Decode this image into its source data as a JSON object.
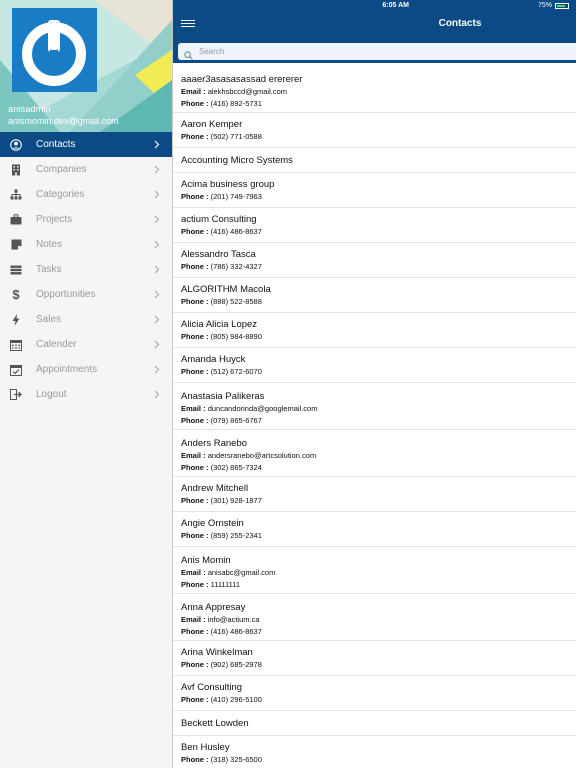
{
  "status_bar": {
    "time": "6:05 AM",
    "battery": "75%",
    "battery_level": 0.75
  },
  "navbar": {
    "title": "Contacts"
  },
  "search": {
    "placeholder": "Search"
  },
  "profile": {
    "name": "anisadmin",
    "email": "anismomin.dev@gmail.com"
  },
  "menu": [
    {
      "label": "Contacts",
      "icon": "user-circle-icon",
      "active": true
    },
    {
      "label": "Companies",
      "icon": "building-icon"
    },
    {
      "label": "Categories",
      "icon": "hierarchy-icon"
    },
    {
      "label": "Projects",
      "icon": "briefcase-icon"
    },
    {
      "label": "Notes",
      "icon": "note-icon"
    },
    {
      "label": "Tasks",
      "icon": "tasks-icon"
    },
    {
      "label": "Opportunities",
      "icon": "dollar-icon"
    },
    {
      "label": "Sales",
      "icon": "lightning-icon"
    },
    {
      "label": "Calender",
      "icon": "calendar-icon"
    },
    {
      "label": "Appointments",
      "icon": "calendar-check-icon"
    },
    {
      "label": "Logout",
      "icon": "logout-icon"
    }
  ],
  "contacts": [
    {
      "name": "aaaer3asasasassad erererer",
      "email": "alekhsbccd@gmail.com",
      "phone": "(416) 892-5731"
    },
    {
      "name": "Aaron Kemper",
      "phone": "(502) 771-0588"
    },
    {
      "name": "Accounting Micro Systems"
    },
    {
      "name": "Acima business group",
      "phone": "(201) 749-7963"
    },
    {
      "name": "actium Consulting",
      "phone": "(416) 486-8637"
    },
    {
      "name": "Alessandro Tasca",
      "phone": "(786) 332-4327"
    },
    {
      "name": "ALGORITHM Macola",
      "phone": "(888) 522-8588"
    },
    {
      "name": "Alicia Alicia Lopez",
      "phone": "(805) 984-8890"
    },
    {
      "name": "Amanda Huyck",
      "phone": "(512) 672-6070"
    },
    {
      "name": "Anastasia Palikeras",
      "email": "duncandorinda@googlemail.com",
      "phone": "(079) 865-6767"
    },
    {
      "name": "Anders Ranebo",
      "email": "andersranebo@artcsolution.com",
      "phone": "(302) 865-7324"
    },
    {
      "name": "Andrew Mitchell",
      "phone": "(301) 928-1877"
    },
    {
      "name": "Angie Ornstein",
      "phone": "(859) 255-2341"
    },
    {
      "name": "Anis Momin",
      "email": "anisabc@gmail.com",
      "phone": "11111111"
    },
    {
      "name": "Anna Appresay",
      "email": "info@actium.ca",
      "phone": "(416) 486-8637"
    },
    {
      "name": "Arina Winkelman",
      "phone": "(902) 685-2978"
    },
    {
      "name": "Avf Consulting",
      "phone": "(410) 296-5100"
    },
    {
      "name": "Beckett Lowden"
    },
    {
      "name": "Ben Husley",
      "phone": "(318) 325-6500"
    }
  ],
  "labels": {
    "email": "Email :",
    "phone": "Phone :"
  }
}
